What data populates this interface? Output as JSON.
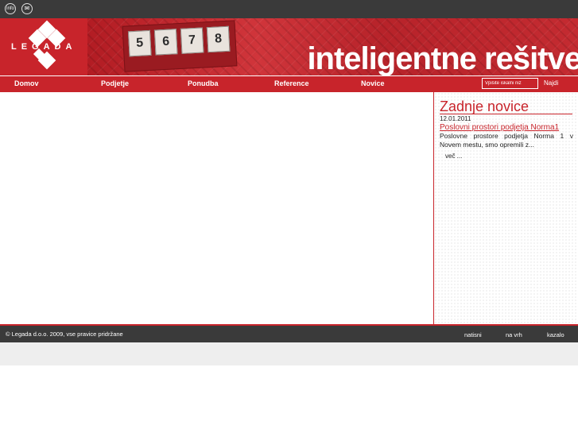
{
  "topbar": {
    "icons": [
      {
        "name": "info-icon",
        "label": "info"
      },
      {
        "name": "mail-icon",
        "label": "✉"
      }
    ]
  },
  "banner": {
    "logo_text": "LEGADA",
    "tagline": "inteligentne rešitve",
    "keypad": [
      "5",
      "6",
      "7",
      "8"
    ]
  },
  "nav": {
    "items": [
      "Domov",
      "Podjetje",
      "Ponudba",
      "Reference",
      "Novice"
    ],
    "search_placeholder": "Vpišite iskalni niz",
    "search_button": "Najdi"
  },
  "sidebar": {
    "title": "Zadnje novice",
    "date": "12.01.2011",
    "headline": "Poslovni prostori podjetja Norma1",
    "body": "Poslovne prostore podjetja Norma 1 v Novem mestu, smo opremili z...",
    "more": "več ..."
  },
  "footer": {
    "copyright": "© Legada d.o.o. 2009, vse pravice pridržane",
    "links": [
      "natisni",
      "na vrh",
      "kazalo"
    ]
  },
  "colors": {
    "brand_red": "#c8242b",
    "dark_bar": "#3a3a3a"
  }
}
